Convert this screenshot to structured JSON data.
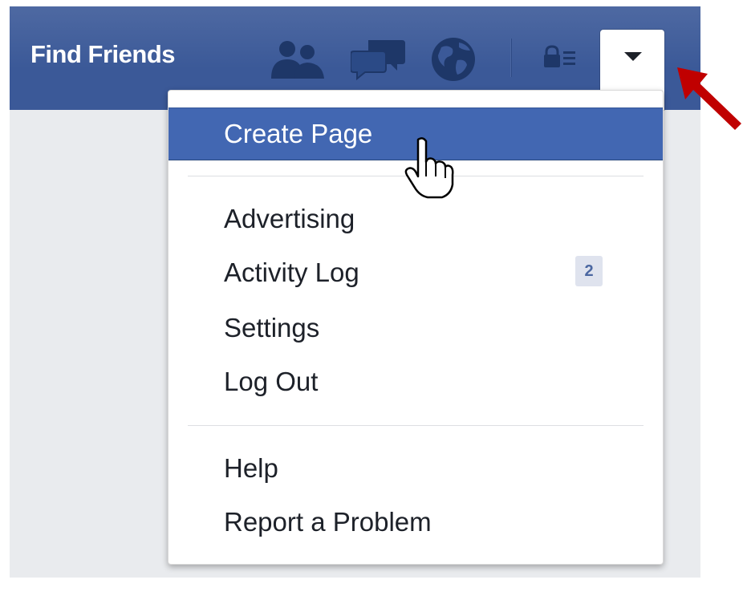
{
  "header": {
    "find_friends_label": "Find Friends",
    "icons": [
      "friends-icon",
      "messages-icon",
      "notifications-globe-icon",
      "privacy-shortcuts-icon",
      "account-dropdown-caret-icon"
    ]
  },
  "menu": {
    "items": [
      {
        "label": "Create Page",
        "highlighted": true
      },
      {
        "label": "Advertising"
      },
      {
        "label": "Activity Log",
        "badge": "2"
      },
      {
        "label": "Settings"
      },
      {
        "label": "Log Out"
      },
      {
        "label": "Help"
      },
      {
        "label": "Report a Problem"
      }
    ]
  },
  "colors": {
    "brand_blue": "#3b5998",
    "highlight_blue": "#4267b2",
    "annotation_arrow": "#c00000",
    "page_background": "#e9ebee"
  }
}
